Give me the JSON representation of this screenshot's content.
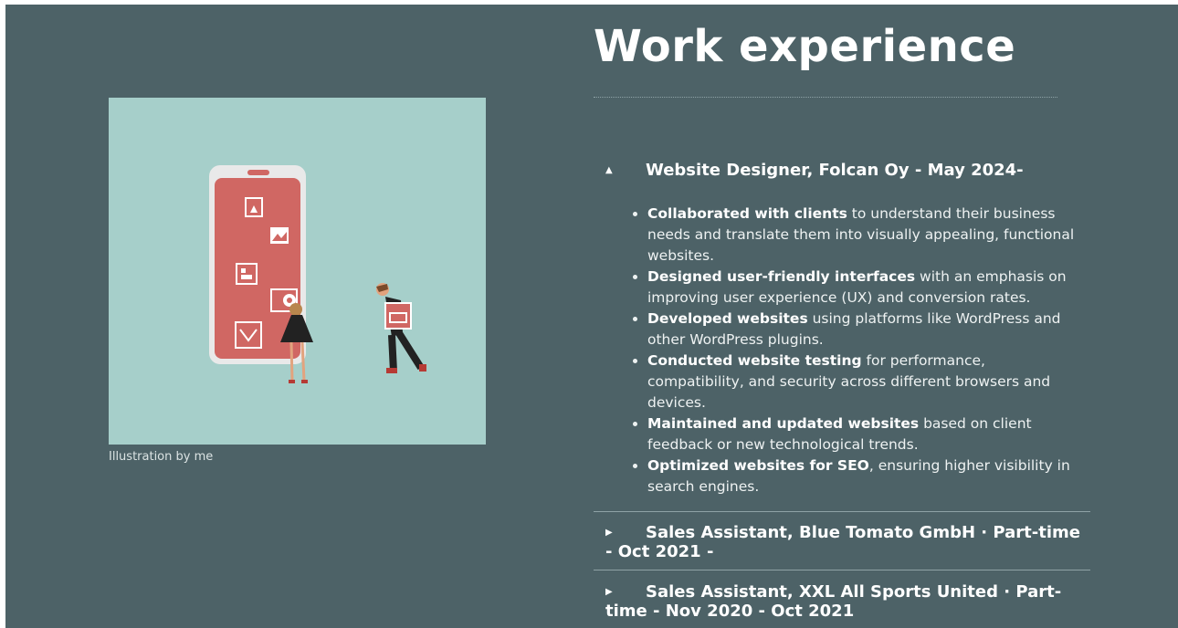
{
  "section": {
    "title": "Work experience"
  },
  "figure": {
    "caption": "Illustration by me"
  },
  "jobs": [
    {
      "caret": "▲",
      "heading": "Website Designer, Folcan Oy - May 2024-",
      "expanded": true,
      "duties": [
        {
          "bold": "Collaborated with clients",
          "text": " to understand their business needs and translate them into visually appealing, functional websites."
        },
        {
          "bold": "Designed user-friendly interfaces",
          "text": " with an emphasis on improving user experience (UX) and conversion rates."
        },
        {
          "bold": "Developed websites",
          "text": " using platforms like WordPress and other WordPress plugins."
        },
        {
          "bold": "Conducted website testing",
          "text": " for performance, compatibility, and security across different browsers and devices."
        },
        {
          "bold": "Maintained and updated websites",
          "text": " based on client feedback or new technological trends."
        },
        {
          "bold": "Optimized websites for SEO",
          "text": ", ensuring higher visibility in search engines."
        }
      ]
    },
    {
      "caret": "▶",
      "heading": "Sales Assistant, Blue Tomato GmbH · Part-time - Oct 2021 -",
      "expanded": false
    },
    {
      "caret": "▶",
      "heading": "Sales Assistant, XXL All Sports United · Part-time - Nov 2020 - Oct 2021",
      "expanded": false
    }
  ],
  "colors": {
    "page_bg": "#4d6267",
    "figure_bg": "#a6cfca",
    "phone_red": "#d06763"
  }
}
